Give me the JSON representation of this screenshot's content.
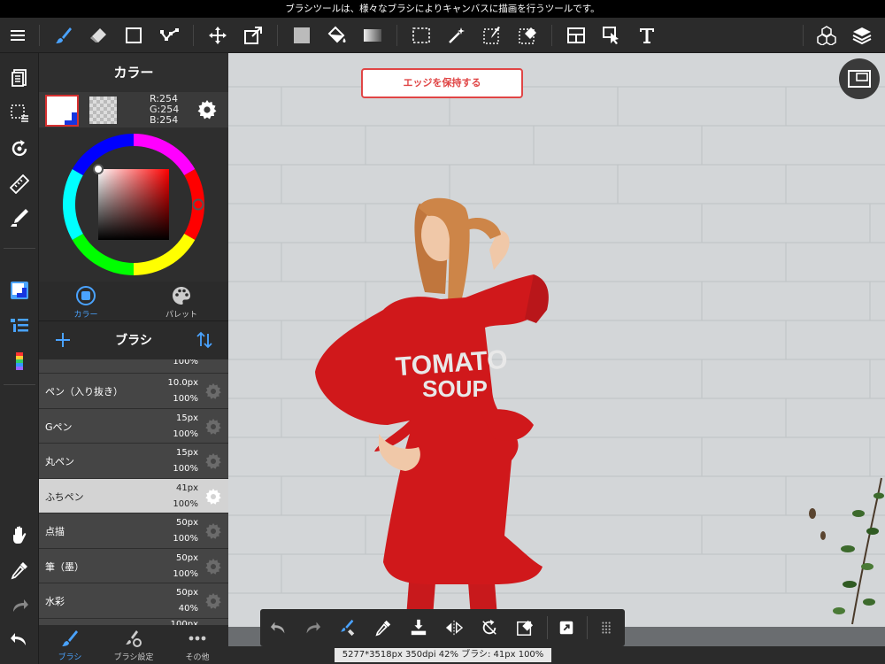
{
  "hint": "ブラシツールは、様々なブラシによりキャンバスに描画を行うツールです。",
  "toolbar": {
    "icons": [
      "menu-icon",
      "brush-icon",
      "eraser-icon",
      "rectangle-icon",
      "polyline-icon",
      "move-icon",
      "transform-icon",
      "fill-color-icon",
      "bucket-icon",
      "gradient-icon",
      "select-rect-icon",
      "magic-wand-icon",
      "select-pen-icon",
      "select-eraser-icon",
      "frame-icon",
      "operation-icon",
      "text-icon",
      "material-icon",
      "layers-icon"
    ]
  },
  "color_panel": {
    "title": "カラー",
    "r": "R:254",
    "g": "G:254",
    "b": "B:254",
    "main_color": "#fefefe",
    "sub_color": "#1736e0",
    "tab_color": "カラー",
    "tab_palette": "パレット"
  },
  "brush_panel": {
    "title": "ブラシ",
    "top_partial": "100%",
    "items": [
      {
        "name": "ペン（入り抜き）",
        "size": "10.0px",
        "opacity": "100%"
      },
      {
        "name": "Gペン",
        "size": "15px",
        "opacity": "100%"
      },
      {
        "name": "丸ペン",
        "size": "15px",
        "opacity": "100%"
      },
      {
        "name": "ふちペン",
        "size": "41px",
        "opacity": "100%"
      },
      {
        "name": "点描",
        "size": "50px",
        "opacity": "100%"
      },
      {
        "name": "筆（墨）",
        "size": "50px",
        "opacity": "100%"
      },
      {
        "name": "水彩",
        "size": "50px",
        "opacity": "40%"
      }
    ],
    "bottom_partial": "100px",
    "tabs": {
      "brush": "ブラシ",
      "settings": "ブラシ設定",
      "other": "その他"
    }
  },
  "canvas": {
    "edge_button": "エッジを保持する",
    "shirt_line1": "TOMATO",
    "shirt_line2": "SOUP",
    "accent": "#d0181b"
  },
  "status": "5277*3518px 350dpi 42% ブラシ: 41px 100%"
}
